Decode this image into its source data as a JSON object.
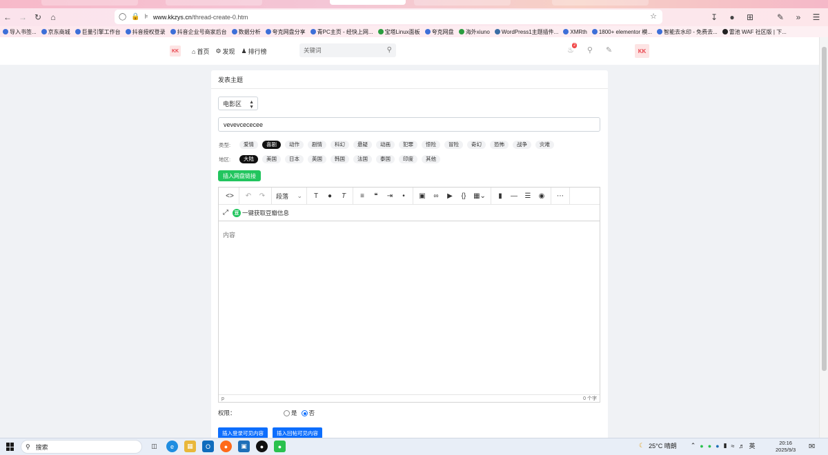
{
  "browser": {
    "url_host": "www.kkzys.cn",
    "url_path": "/thread-create-0.htm",
    "bookmarks": [
      "导入书签...",
      "京东商城",
      "巨量引擎工作台",
      "抖音授权登录",
      "抖音企业号商家后台",
      "数据分析",
      "夸克网盘分享",
      "青PC主页 - 经快上网...",
      "宝塔Linux面板",
      "夸克网盘",
      "海外xiuno",
      "WordPress1主题插件...",
      "XMRth",
      "1800+ elementor 模...",
      "智能去水印 - 免费去...",
      "雷池 WAF 社区版 | 下..."
    ]
  },
  "header": {
    "logo_text": "KK",
    "nav": [
      {
        "label": "首页",
        "icon": "home-icon"
      },
      {
        "label": "发现",
        "icon": "gear-icon"
      },
      {
        "label": "排行榜",
        "icon": "users-icon"
      }
    ],
    "search_placeholder": "关键词",
    "notification_count": "2",
    "avatar_text": "KK"
  },
  "form": {
    "card_title": "发表主题",
    "forum_select": "电影区",
    "title_value": "vevevcececee",
    "type_label": "类型:",
    "types": [
      "爱情",
      "喜剧",
      "动作",
      "剧情",
      "科幻",
      "悬疑",
      "动画",
      "犯罪",
      "惊险",
      "冒险",
      "奇幻",
      "恐怖",
      "战争",
      "灾难"
    ],
    "type_active": "喜剧",
    "region_label": "地区:",
    "regions": [
      "大陆",
      "美国",
      "日本",
      "英国",
      "韩国",
      "法国",
      "泰国",
      "印度",
      "其他"
    ],
    "region_active": "大陆",
    "insert_link_button": "插入网盘链接",
    "toolbar_paragraph": "段落",
    "douban_button": "一键获取豆瓣信息",
    "content_placeholder": "内容",
    "status_left": "p",
    "status_right": "0 个字",
    "permission_label": "权限：",
    "permission_yes": "是",
    "permission_no": "否",
    "permission_selected": "否",
    "login_visible_button": "插入登录可见内容",
    "reply_visible_button": "插入回帖可见内容"
  },
  "taskbar": {
    "search_label": "搜索",
    "weather": "25°C 晴朗",
    "ime": "英",
    "time": "20:16",
    "date": "2025/9/3"
  }
}
